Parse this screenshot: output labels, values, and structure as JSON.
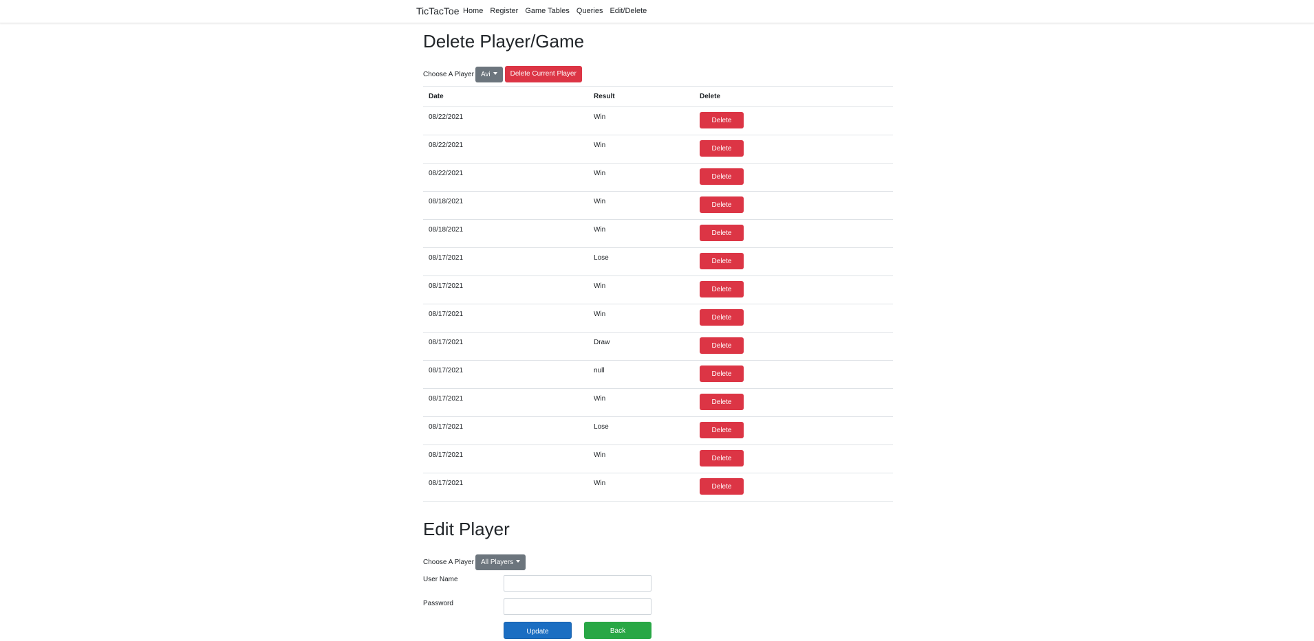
{
  "navbar": {
    "brand": "TicTacToe",
    "links": [
      "Home",
      "Register",
      "Game Tables",
      "Queries",
      "Edit/Delete"
    ]
  },
  "delete_section": {
    "title": "Delete Player/Game",
    "choose_label": "Choose A Player",
    "selected_player": "Avi",
    "delete_player_label": "Delete Current Player",
    "table": {
      "headers": [
        "Date",
        "Result",
        "Delete"
      ],
      "delete_label": "Delete",
      "rows": [
        {
          "date": "08/22/2021",
          "result": "Win"
        },
        {
          "date": "08/22/2021",
          "result": "Win"
        },
        {
          "date": "08/22/2021",
          "result": "Win"
        },
        {
          "date": "08/18/2021",
          "result": "Win"
        },
        {
          "date": "08/18/2021",
          "result": "Win"
        },
        {
          "date": "08/17/2021",
          "result": "Lose"
        },
        {
          "date": "08/17/2021",
          "result": "Win"
        },
        {
          "date": "08/17/2021",
          "result": "Win"
        },
        {
          "date": "08/17/2021",
          "result": "Draw"
        },
        {
          "date": "08/17/2021",
          "result": "null"
        },
        {
          "date": "08/17/2021",
          "result": "Win"
        },
        {
          "date": "08/17/2021",
          "result": "Lose"
        },
        {
          "date": "08/17/2021",
          "result": "Win"
        },
        {
          "date": "08/17/2021",
          "result": "Win"
        }
      ]
    }
  },
  "edit_section": {
    "title": "Edit Player",
    "choose_label": "Choose A Player",
    "selected_player": "All Players",
    "username_label": "User Name",
    "username_value": "",
    "password_label": "Password",
    "password_value": "",
    "update_label": "Update",
    "back_label": "Back"
  },
  "colors": {
    "danger": "#dc3545",
    "secondary": "#6c757d",
    "primary": "#1b6ec2",
    "success": "#28a745"
  }
}
